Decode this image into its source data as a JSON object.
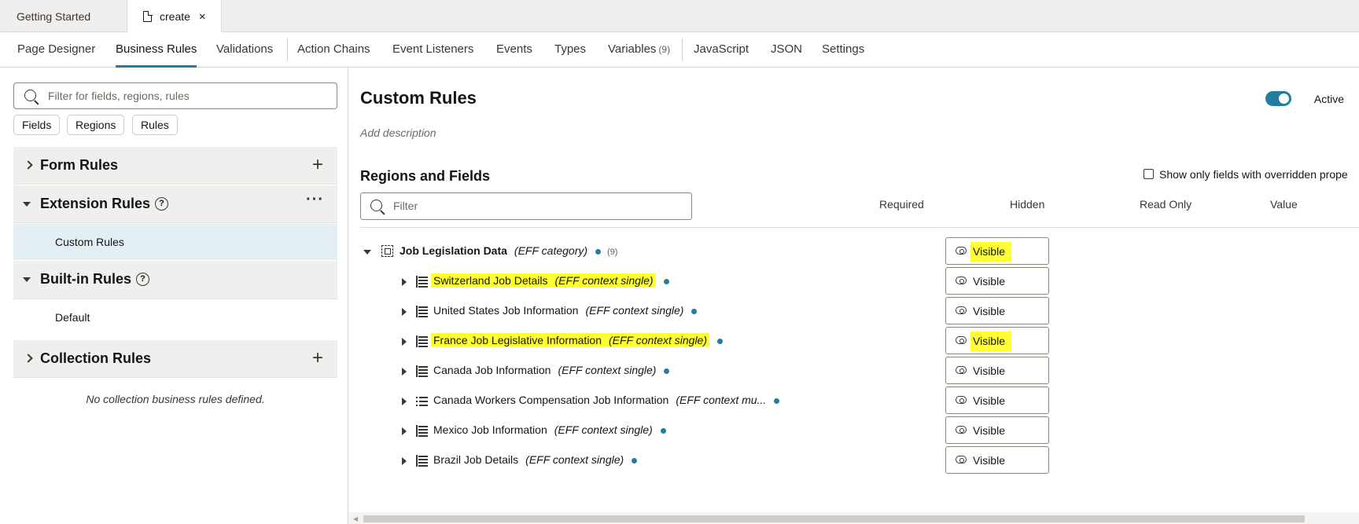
{
  "file_tabs": [
    {
      "label": "Getting Started"
    },
    {
      "label": "create"
    }
  ],
  "nav": {
    "items": [
      "Page Designer",
      "Business Rules",
      "Validations",
      "Action Chains",
      "Event Listeners",
      "Events",
      "Types",
      "Variables",
      "JavaScript",
      "JSON",
      "Settings"
    ],
    "active": "Business Rules",
    "variables_count": "(9)"
  },
  "left": {
    "search_placeholder": "Filter for fields, regions, rules",
    "chips": [
      "Fields",
      "Regions",
      "Rules"
    ],
    "form_rules": "Form Rules",
    "extension_rules": "Extension Rules",
    "extension_items": [
      "Custom Rules"
    ],
    "builtin_rules": "Built-in Rules",
    "builtin_items": [
      "Default"
    ],
    "collection_rules": "Collection Rules",
    "collection_empty": "No collection business rules defined.",
    "help_glyph": "?",
    "more_glyph": "···",
    "plus_glyph": "+"
  },
  "main": {
    "title": "Custom Rules",
    "active_label": "Active",
    "active": true,
    "add_description": "Add description",
    "regions_title": "Regions and Fields",
    "show_only_label": "Show only fields with overridden prope",
    "filter_placeholder": "Filter",
    "columns": [
      "Required",
      "Hidden",
      "Read Only",
      "Value"
    ],
    "category": {
      "name": "Job Legislation Data",
      "type": "(EFF category)",
      "count": "(9)",
      "hidden": "Visible",
      "highlight": true
    },
    "rows": [
      {
        "name": "Switzerland Job Details",
        "type": "(EFF context single)",
        "hidden": "Visible",
        "highlight": true,
        "btn_highlight": false
      },
      {
        "name": "United States Job Information",
        "type": "(EFF context single)",
        "hidden": "Visible",
        "highlight": false,
        "btn_highlight": false
      },
      {
        "name": "France Job Legislative Information",
        "type": "(EFF context single)",
        "hidden": "Visible",
        "highlight": true,
        "btn_highlight": true
      },
      {
        "name": "Canada Job Information",
        "type": "(EFF context single)",
        "hidden": "Visible",
        "highlight": false,
        "btn_highlight": false
      },
      {
        "name": "Canada Workers Compensation Job Information",
        "type": "(EFF context mu...",
        "hidden": "Visible",
        "highlight": false,
        "btn_highlight": false
      },
      {
        "name": "Mexico Job Information",
        "type": "(EFF context single)",
        "hidden": "Visible",
        "highlight": false,
        "btn_highlight": false
      },
      {
        "name": "Brazil Job Details",
        "type": "(EFF context single)",
        "hidden": "Visible",
        "highlight": false,
        "btn_highlight": false
      }
    ]
  },
  "colors": {
    "accent": "#227e9e",
    "highlight": "#ffff33"
  }
}
